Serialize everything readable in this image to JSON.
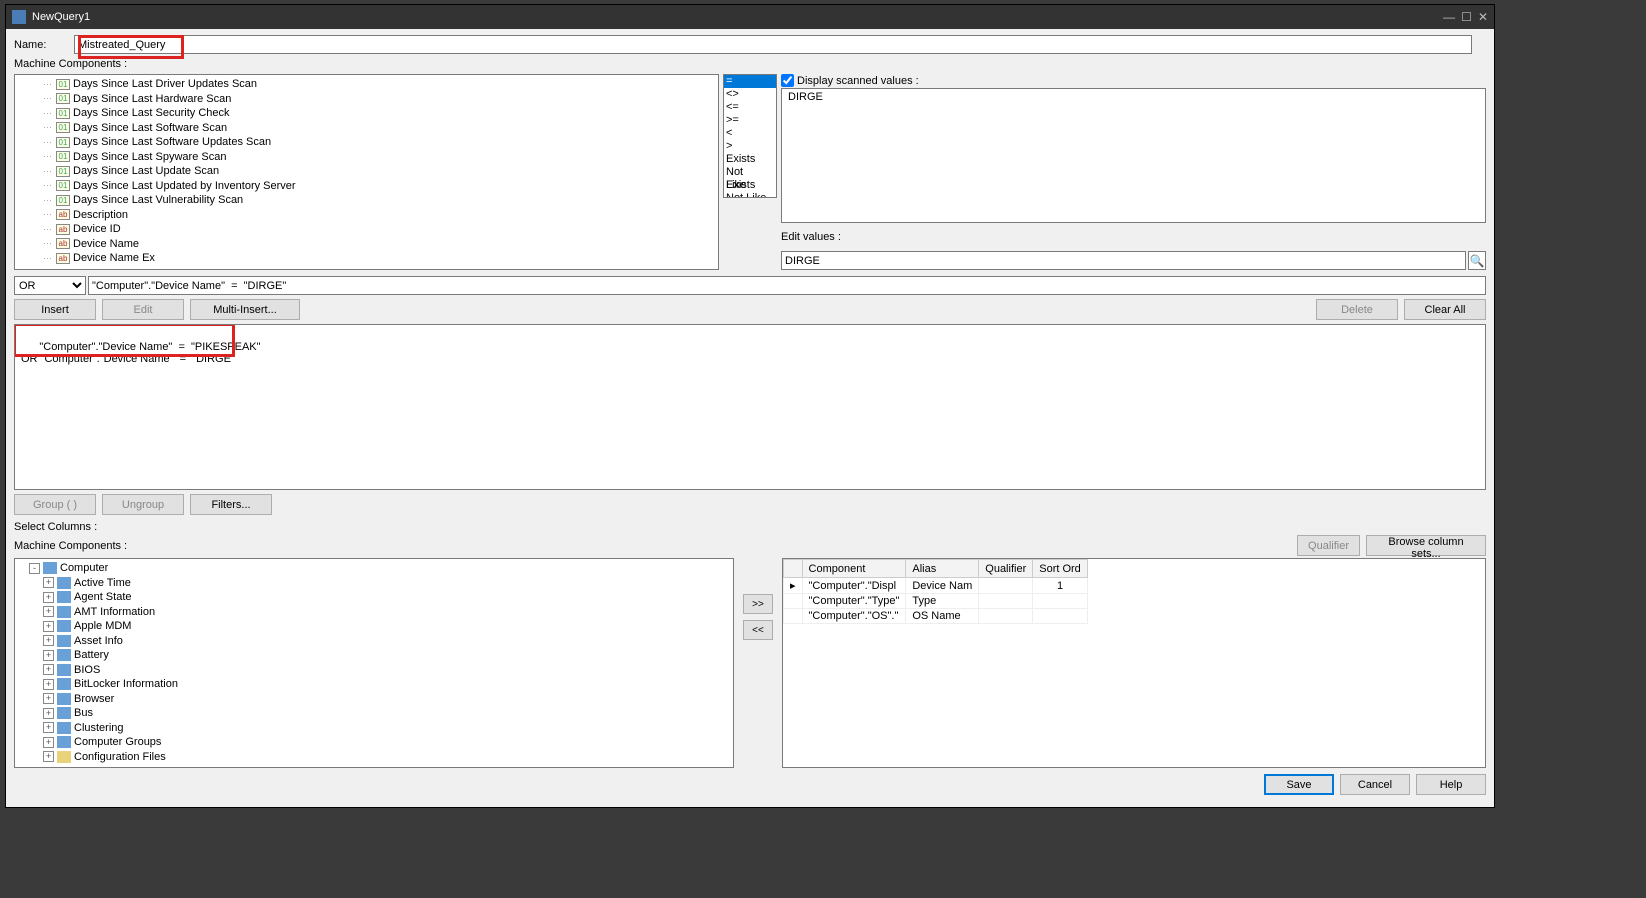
{
  "title": "NewQuery1",
  "name_label": "Name:",
  "name_value": "Mistreated_Query",
  "mc_label_1": "Machine Components :",
  "tree1": [
    {
      "ic": "01",
      "t": "Days Since Last Driver Updates Scan"
    },
    {
      "ic": "01",
      "t": "Days Since Last Hardware Scan"
    },
    {
      "ic": "01",
      "t": "Days Since Last Security Check"
    },
    {
      "ic": "01",
      "t": "Days Since Last Software Scan"
    },
    {
      "ic": "01",
      "t": "Days Since Last Software Updates Scan"
    },
    {
      "ic": "01",
      "t": "Days Since Last Spyware Scan"
    },
    {
      "ic": "01",
      "t": "Days Since Last Update Scan"
    },
    {
      "ic": "01",
      "t": "Days Since Last Updated by Inventory Server"
    },
    {
      "ic": "01",
      "t": "Days Since Last Vulnerability Scan"
    },
    {
      "ic": "ab",
      "t": "Description"
    },
    {
      "ic": "ab",
      "t": "Device ID"
    },
    {
      "ic": "ab",
      "t": "Device Name"
    },
    {
      "ic": "ab",
      "t": "Device Name Ex"
    }
  ],
  "operators": [
    "=",
    "<>",
    "<=",
    ">=",
    "<",
    ">",
    "Exists",
    "Not Exists",
    "Like",
    "Not Like"
  ],
  "display_scanned_label": "Display scanned values :",
  "scanned_value": "DIRGE",
  "edit_values_label": "Edit values :",
  "edit_value": "DIRGE",
  "cond_op": "OR",
  "cond_text": "\"Computer\".\"Device Name\"  =  \"DIRGE\"",
  "btns": {
    "insert": "Insert",
    "edit": "Edit",
    "multi": "Multi-Insert...",
    "del": "Delete",
    "clear": "Clear All",
    "group": "Group ( )",
    "ungroup": "Ungroup",
    "filters": "Filters...",
    "qualifier": "Qualifier",
    "browse": "Browse column sets...",
    "add": ">>",
    "rem": "<<",
    "save": "Save",
    "cancel": "Cancel",
    "help": "Help"
  },
  "query_text": "\"Computer\".\"Device Name\"  =  \"PIKESPEAK\"\nOR \"Computer\".\"Device Name\"  =  \"DIRGE\"",
  "select_cols_label": "Select Columns :",
  "mc_label_2": "Machine Components :",
  "tree2": [
    {
      "lvl": "root",
      "exp": "-",
      "ic": "c",
      "t": "Computer"
    },
    {
      "lvl": "child",
      "exp": "+",
      "ic": "c",
      "t": "Active Time"
    },
    {
      "lvl": "child",
      "exp": "+",
      "ic": "c",
      "t": "Agent State"
    },
    {
      "lvl": "child",
      "exp": "+",
      "ic": "c",
      "t": "AMT Information"
    },
    {
      "lvl": "child",
      "exp": "+",
      "ic": "c",
      "t": "Apple MDM"
    },
    {
      "lvl": "child",
      "exp": "+",
      "ic": "c",
      "t": "Asset Info"
    },
    {
      "lvl": "child",
      "exp": "+",
      "ic": "c",
      "t": "Battery"
    },
    {
      "lvl": "child",
      "exp": "+",
      "ic": "c",
      "t": "BIOS"
    },
    {
      "lvl": "child",
      "exp": "+",
      "ic": "c",
      "t": "BitLocker Information"
    },
    {
      "lvl": "child",
      "exp": "+",
      "ic": "c",
      "t": "Browser"
    },
    {
      "lvl": "child",
      "exp": "+",
      "ic": "c",
      "t": "Bus"
    },
    {
      "lvl": "child",
      "exp": "+",
      "ic": "c",
      "t": "Clustering"
    },
    {
      "lvl": "child",
      "exp": "+",
      "ic": "c",
      "t": "Computer Groups"
    },
    {
      "lvl": "child",
      "exp": "+",
      "ic": "f",
      "t": "Configuration Files"
    }
  ],
  "grid": {
    "headers": [
      "",
      "Component",
      "Alias",
      "Qualifier",
      "Sort Ord"
    ],
    "rows": [
      {
        "ptr": "▸",
        "comp": "\"Computer\".\"Displ",
        "alias": "Device Nam",
        "qual": "",
        "sort": "1"
      },
      {
        "ptr": "",
        "comp": "\"Computer\".\"Type\"",
        "alias": "Type",
        "qual": "",
        "sort": ""
      },
      {
        "ptr": "",
        "comp": "\"Computer\".\"OS\".\"",
        "alias": "OS Name",
        "qual": "",
        "sort": ""
      }
    ]
  }
}
